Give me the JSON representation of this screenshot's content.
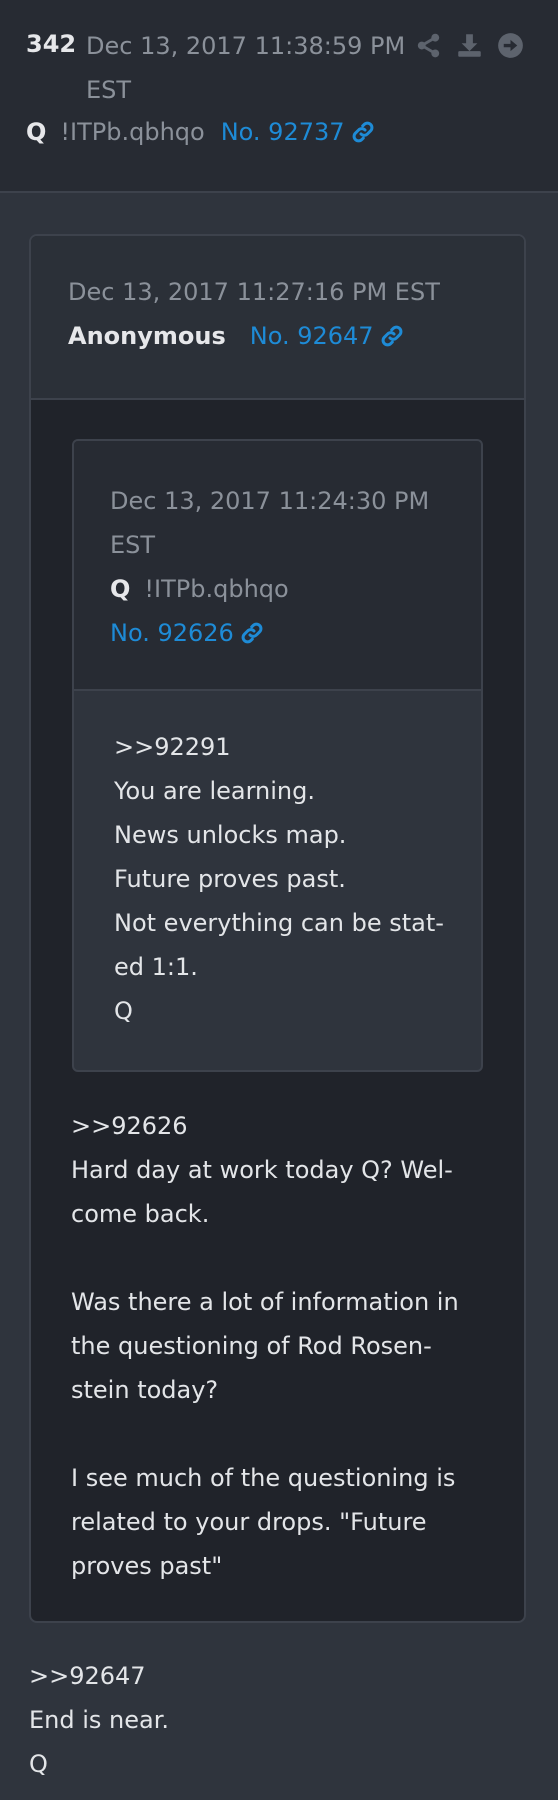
{
  "post": {
    "number": "342",
    "date": "Dec 13, 2017 11:38:59 PM EST",
    "author": "Q",
    "tripcode": "!ITPb.qbhqo",
    "post_id": "No. 92737",
    "icons": [
      "share-icon",
      "download-icon",
      "arrow-right-circle-icon",
      "link-icon"
    ],
    "body": [
      ">>92647",
      "End is near.",
      "Q"
    ]
  },
  "quoted": {
    "date": "Dec 13, 2017 11:27:16 PM EST",
    "author": "Anonymous",
    "post_id": "No. 92647",
    "body": {
      "p1": [
        ">>92626",
        "Hard day at work today Q? Wel-",
        "come back."
      ],
      "p2": [
        "Was there a lot of information in",
        "the questioning of Rod Rosen-",
        "stein today?"
      ],
      "p3": [
        "I see much of the questioning is",
        "related to your drops.  \"Future",
        "proves past\""
      ]
    }
  },
  "nested": {
    "date_line1": "Dec 13, 2017 11:24:30 PM",
    "date_line2": "EST",
    "author": "Q",
    "tripcode": "!ITPb.qbhqo",
    "post_id": "No. 92626",
    "body": [
      ">>92291",
      "You are learning.",
      "News unlocks map.",
      "Future proves past.",
      "Not everything can be stat-",
      "ed 1:1.",
      "Q"
    ]
  },
  "colors": {
    "background": "#2f343d",
    "header_bg": "#272b33",
    "quote_bg": "#20232a",
    "link": "#1e8bd6",
    "muted": "#8b919a"
  }
}
